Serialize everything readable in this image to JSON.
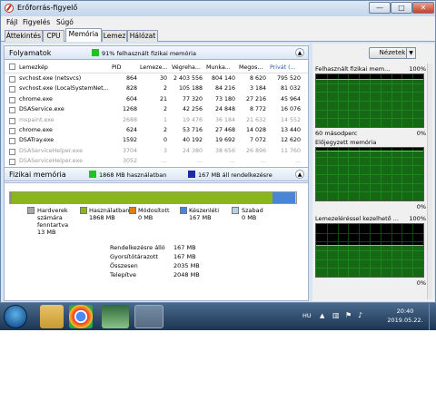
{
  "window": {
    "title": "Erőforrás-figyelő"
  },
  "menu": [
    "Fájl",
    "Figyelés",
    "Súgó"
  ],
  "tabs": [
    "Áttekintés",
    "CPU",
    "Memória",
    "Lemez",
    "Hálózat"
  ],
  "active_tab": "Memória",
  "processes": {
    "title": "Folyamatok",
    "hint": "91% felhasznált fizikai memória",
    "hint_color": "#22c222",
    "columns": [
      "Lemezkép",
      "PID",
      "Lemeze...",
      "Végreha...",
      "Munka...",
      "Megos...",
      "Privát (..."
    ],
    "rows": [
      {
        "name": "svchost.exe (netsvcs)",
        "pid": "864",
        "c3": "30",
        "c4": "2 403 556",
        "c5": "804 140",
        "c6": "8 620",
        "c7": "795 520",
        "dim": false
      },
      {
        "name": "svchost.exe (LocalSystemNet...",
        "pid": "828",
        "c3": "2",
        "c4": "105 188",
        "c5": "84 216",
        "c6": "3 184",
        "c7": "81 032",
        "dim": false
      },
      {
        "name": "chrome.exe",
        "pid": "604",
        "c3": "21",
        "c4": "77 320",
        "c5": "73 180",
        "c6": "27 216",
        "c7": "45 964",
        "dim": false
      },
      {
        "name": "DSAService.exe",
        "pid": "1268",
        "c3": "2",
        "c4": "42 256",
        "c5": "24 848",
        "c6": "8 772",
        "c7": "16 076",
        "dim": false
      },
      {
        "name": "mspaint.exe",
        "pid": "2688",
        "c3": "1",
        "c4": "19 476",
        "c5": "36 184",
        "c6": "21 632",
        "c7": "14 552",
        "dim": true
      },
      {
        "name": "chrome.exe",
        "pid": "624",
        "c3": "2",
        "c4": "53 716",
        "c5": "27 468",
        "c6": "14 028",
        "c7": "13 440",
        "dim": false
      },
      {
        "name": "DSATray.exe",
        "pid": "1592",
        "c3": "0",
        "c4": "40 192",
        "c5": "19 692",
        "c6": "7 072",
        "c7": "12 620",
        "dim": false
      },
      {
        "name": "DSAServiceHelper.exe",
        "pid": "3704",
        "c3": "3",
        "c4": "24 380",
        "c5": "38 656",
        "c6": "26 896",
        "c7": "11 760",
        "dim": true
      },
      {
        "name": "DSAServiceHelper.exe",
        "pid": "3052",
        "c3": "...",
        "c4": "...",
        "c5": "...",
        "c6": "...",
        "c7": "...",
        "dim": true
      }
    ]
  },
  "physical_memory": {
    "title": "Fizikai memória",
    "hint_used": "1868 MB használatban",
    "hint_avail": "167 MB áll rendelkezésre",
    "used_color": "#22c222",
    "avail_color": "#1a2aa8",
    "bar": [
      {
        "label": "Hardver",
        "fraction": 0.006,
        "color": "#8c8c8c"
      },
      {
        "label": "Használatban",
        "fraction": 0.911,
        "color": "#8ab51b"
      },
      {
        "label": "Módosított",
        "fraction": 0.0,
        "color": "#e07c14"
      },
      {
        "label": "Készenléti",
        "fraction": 0.081,
        "color": "#4a86d8"
      },
      {
        "label": "Szabad",
        "fraction": 0.002,
        "color": "#b6d0ea"
      }
    ],
    "legend": [
      {
        "label": "Hardverek számára fenntartva",
        "value": "13 MB",
        "color": "#a8a8a8"
      },
      {
        "label": "Használatban",
        "value": "1868 MB",
        "color": "#8ab51b"
      },
      {
        "label": "Módosított",
        "value": "0 MB",
        "color": "#e07c14"
      },
      {
        "label": "Készenléti",
        "value": "167 MB",
        "color": "#4a86d8"
      },
      {
        "label": "Szabad",
        "value": "0 MB",
        "color": "#b6d0ea"
      }
    ],
    "stats": [
      {
        "label": "Rendelkezésre álló",
        "value": "167 MB"
      },
      {
        "label": "Gyorsítótárazott",
        "value": "167 MB"
      },
      {
        "label": "Összesen",
        "value": "2035 MB"
      },
      {
        "label": "Telepítve",
        "value": "2048 MB"
      }
    ]
  },
  "views_button": "Nézetek",
  "graphs": [
    {
      "title": "Felhasznált fizikai mem...",
      "max": "100%",
      "footer_left": "60 másodperc",
      "footer_right": "0%",
      "level": 0.91
    },
    {
      "title": "Előjegyzett memória",
      "max": "100%",
      "footer_left": "",
      "footer_right": "0%",
      "level": 0.95
    },
    {
      "title": "Lemezeléréssel kezelhető ...",
      "max": "100%",
      "footer_left": "",
      "footer_right": "0%",
      "level": 0.6
    }
  ],
  "taskbar": {
    "lang": "HU",
    "time": "20:40",
    "date": "2019.05.22."
  }
}
